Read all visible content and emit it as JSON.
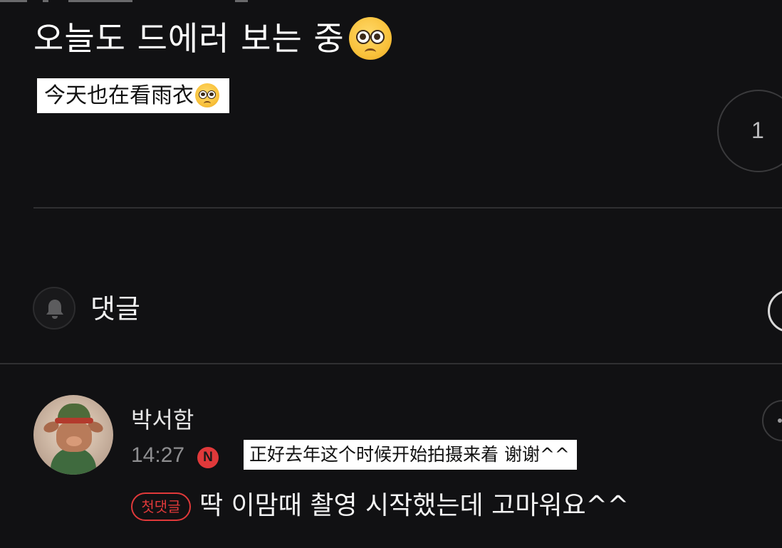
{
  "post": {
    "title": "오늘도 드에러 보는 중",
    "title_emoji": "pleading-face-emoji",
    "subtitle_translation": "今天也在看雨衣",
    "subtitle_emoji": "pleading-face-emoji",
    "reaction_count": "1"
  },
  "comments_section": {
    "label": "댓글",
    "bell_icon": "bell-icon"
  },
  "comment": {
    "author": "박서함",
    "time": "14:27",
    "new_badge": "N",
    "translation": "正好去年这个时候开始拍摄来着 谢谢^^",
    "first_comment_badge": "첫댓글",
    "text": "딱 이맘때 촬영 시작했는데 고마워요^^"
  },
  "colors": {
    "background": "#111113",
    "accent_red": "#e0393a",
    "divider": "#303032",
    "muted_text": "#8e8e90"
  }
}
